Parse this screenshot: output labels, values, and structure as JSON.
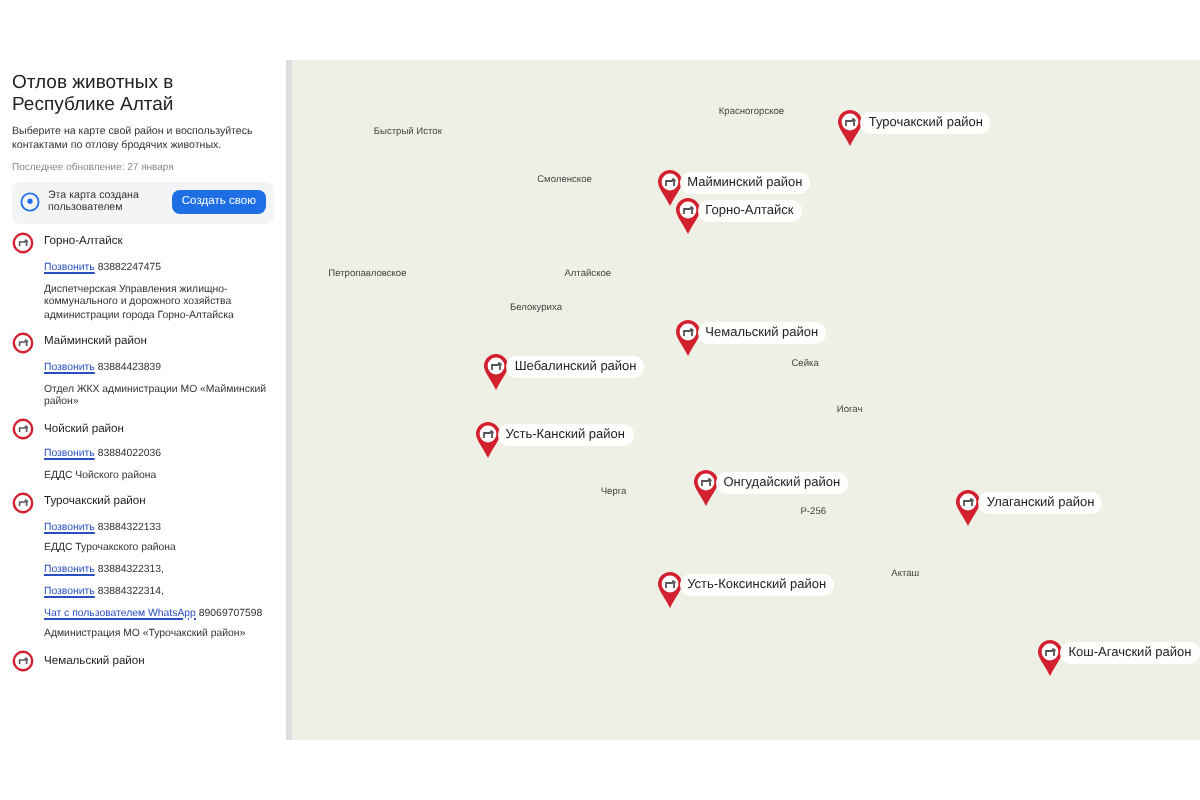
{
  "panel": {
    "title": "Отлов животных в Республике Алтай",
    "description": "Выберите на карте свой район и воспользуйтесь контактами по отлову бродячих животных.",
    "updated": "Последнее обновление: 27 января",
    "notice": {
      "text": "Эта карта создана пользователем",
      "button": "Создать свою"
    },
    "places": [
      {
        "name": "Горно-Алтайск",
        "entries": [
          {
            "kind": "call",
            "link": "Позвонить",
            "value": "83882247475"
          },
          {
            "kind": "text",
            "value": "Диспетчерская Управления жилищно-коммунального и дорожного хозяйства администрации города Горно-Алтайска"
          }
        ]
      },
      {
        "name": "Майминский район",
        "entries": [
          {
            "kind": "call",
            "link": "Позвонить",
            "value": "83884423839"
          },
          {
            "kind": "text",
            "value": "Отдел ЖКХ администрации МО «Майминский район»"
          }
        ]
      },
      {
        "name": "Чойский район",
        "entries": [
          {
            "kind": "call",
            "link": "Позвонить",
            "value": "83884022036"
          },
          {
            "kind": "text",
            "value": "ЕДДС Чойского района"
          }
        ]
      },
      {
        "name": "Турочакский район",
        "entries": [
          {
            "kind": "call",
            "link": "Позвонить",
            "value": "83884322133"
          },
          {
            "kind": "text",
            "value": "ЕДДС Турочакского района"
          },
          {
            "kind": "call",
            "link": "Позвонить",
            "value": "83884322313,"
          },
          {
            "kind": "call",
            "link": "Позвонить",
            "value": "83884322314,"
          },
          {
            "kind": "call",
            "link": "Чат с пользователем WhatsApp",
            "value": "89069707598"
          },
          {
            "kind": "text",
            "value": "Администрация МО «Турочакский район»"
          }
        ]
      },
      {
        "name": "Чемальский район"
      }
    ]
  },
  "map": {
    "towns": [
      "Быстрый Исток",
      "Смоленское",
      "Красногорское",
      "Петропавловское",
      "Белокуриха",
      "Алтайское",
      "Сейка",
      "Иогач",
      "Черга",
      "Акташ",
      "Р-256"
    ],
    "pins": [
      "Турочакский район",
      "Майминский район",
      "Горно-Алтайск",
      "Чемальский район",
      "Шебалинский район",
      "Усть-Канский район",
      "Онгудайский район",
      "Улаганский район",
      "Усть-Коксинский район",
      "Кош-Агачский район"
    ]
  }
}
